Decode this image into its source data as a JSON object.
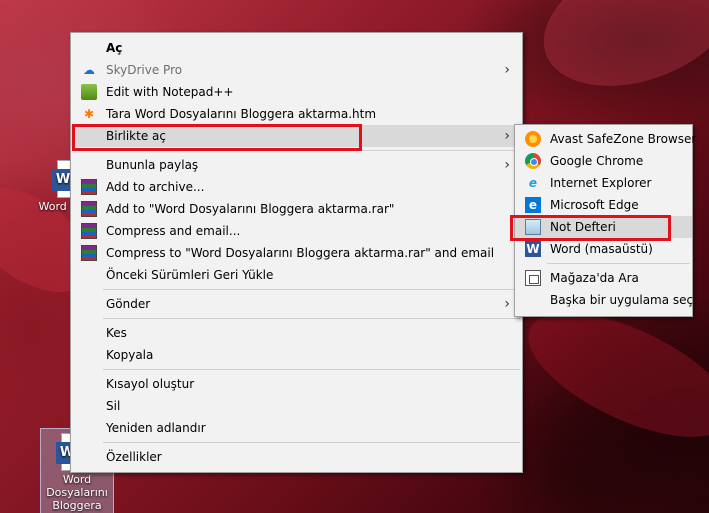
{
  "desktop": {
    "icon_top": {
      "label": "Word Dosyal"
    },
    "icon_bottom": {
      "label": "Word Dosyalarını Bloggera"
    }
  },
  "context_menu": {
    "items": [
      {
        "label": "Aç",
        "bold": true,
        "icon": "none"
      },
      {
        "label": "SkyDrive Pro",
        "disabled": true,
        "icon": "cloud-icon",
        "submenu": true
      },
      {
        "label": "Edit with Notepad++",
        "icon": "notepadpp-icon"
      },
      {
        "label": "Tara Word Dosyalarını Bloggera aktarma.htm",
        "icon": "avast-icon"
      },
      {
        "label": "Birlikte aç",
        "icon": "none",
        "submenu": true,
        "highlighted": true
      },
      {
        "label": "Bununla paylaş",
        "icon": "none",
        "submenu": true
      },
      {
        "label": "Add to archive...",
        "icon": "winrar-icon"
      },
      {
        "label": "Add to \"Word Dosyalarını Bloggera aktarma.rar\"",
        "icon": "winrar-icon"
      },
      {
        "label": "Compress and email...",
        "icon": "winrar-icon"
      },
      {
        "label": "Compress to \"Word Dosyalarını Bloggera aktarma.rar\" and email",
        "icon": "winrar-icon"
      },
      {
        "label": "Önceki Sürümleri Geri Yükle",
        "icon": "none"
      },
      {
        "label": "Gönder",
        "icon": "none",
        "submenu": true
      },
      {
        "label": "Kes",
        "icon": "none"
      },
      {
        "label": "Kopyala",
        "icon": "none"
      },
      {
        "label": "Kısayol oluştur",
        "icon": "none"
      },
      {
        "label": "Sil",
        "icon": "none"
      },
      {
        "label": "Yeniden adlandır",
        "icon": "none"
      },
      {
        "label": "Özellikler",
        "icon": "none"
      }
    ]
  },
  "open_with_menu": {
    "items": [
      {
        "label": "Avast SafeZone Browser",
        "icon": "avast-browser-icon"
      },
      {
        "label": "Google Chrome",
        "icon": "chrome-icon"
      },
      {
        "label": "Internet Explorer",
        "icon": "internet-explorer-icon"
      },
      {
        "label": "Microsoft Edge",
        "icon": "edge-icon"
      },
      {
        "label": "Not Defteri",
        "icon": "notepad-icon",
        "highlighted": true
      },
      {
        "label": "Word (masaüstü)",
        "icon": "word-icon"
      },
      {
        "label": "Mağaza'da Ara",
        "icon": "store-icon"
      },
      {
        "label": "Başka bir uygulama seç",
        "icon": "none"
      }
    ]
  },
  "colors": {
    "highlight_border": "#e0101c",
    "menu_background": "#f2f2f2",
    "hover_background": "#d9d9d9"
  }
}
